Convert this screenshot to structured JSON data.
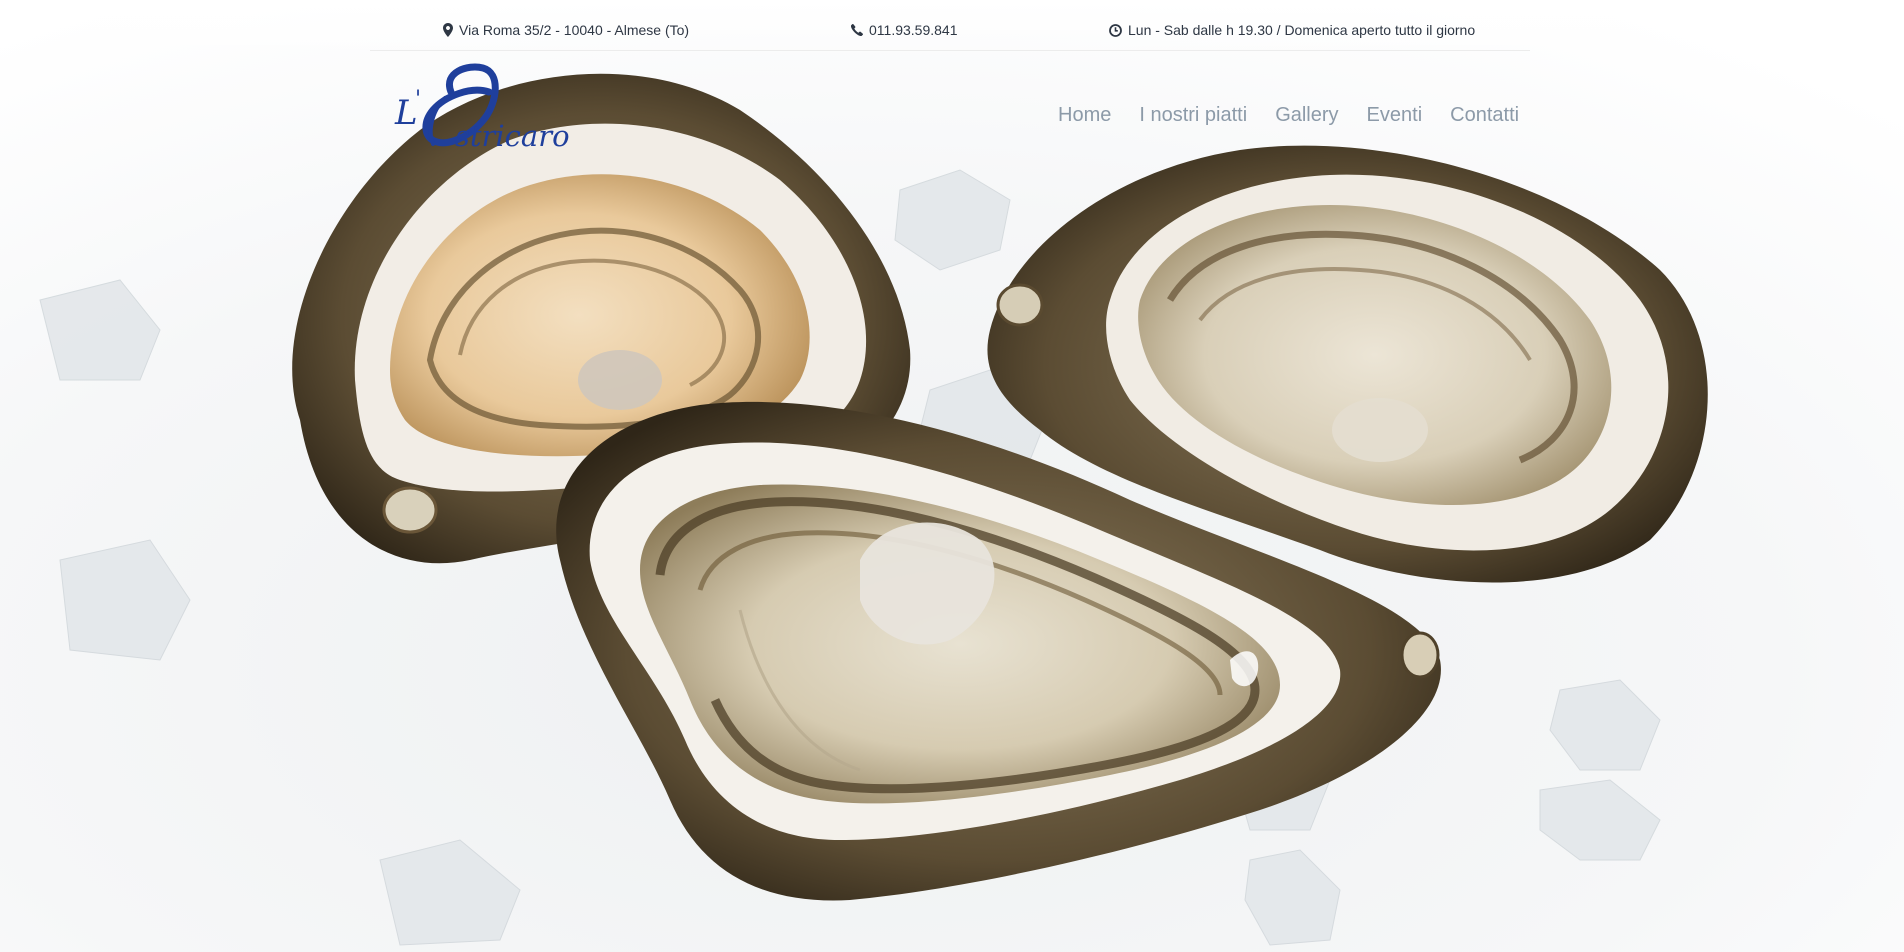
{
  "topbar": {
    "address": {
      "icon": "map-marker-icon",
      "text": "Via Roma 35/2 - 10040 - Almese (To)"
    },
    "phone": {
      "icon": "phone-icon",
      "text": "011.93.59.841"
    },
    "hours": {
      "icon": "clock-icon",
      "text": "Lun - Sab dalle h 19.30 / Domenica aperto tutto il giorno"
    }
  },
  "logo": {
    "text": "L'Ostricaro",
    "color": "#1f3f9c"
  },
  "nav": {
    "items": [
      {
        "label": "Home"
      },
      {
        "label": "I nostri piatti"
      },
      {
        "label": "Gallery"
      },
      {
        "label": "Eventi"
      },
      {
        "label": "Contatti"
      }
    ]
  },
  "hero": {
    "image": "oysters-on-ice-photo"
  },
  "colors": {
    "text": "#2e3744",
    "nav": "#8c9aa8",
    "brand": "#1f3f9c"
  }
}
